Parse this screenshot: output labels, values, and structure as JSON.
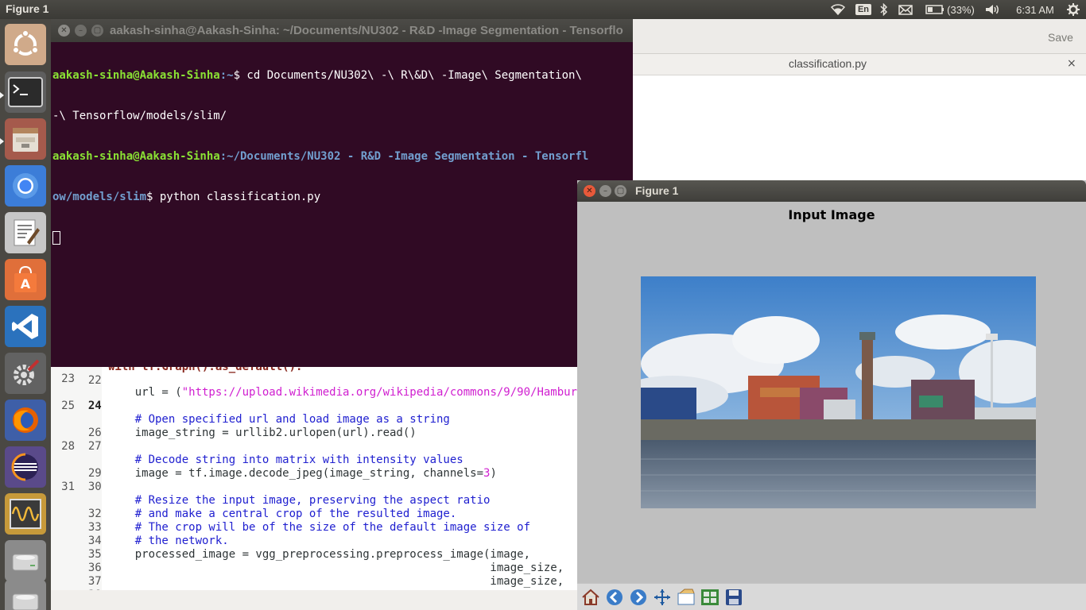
{
  "top_panel": {
    "app_name": "Figure 1",
    "keyboard": "En",
    "battery": "(33%)",
    "time": "6:31 AM"
  },
  "launcher": {
    "icons": [
      "ubuntu-icon",
      "terminal-icon",
      "files-icon",
      "chromium-icon",
      "text-editor-icon",
      "software-center-icon",
      "vscode-icon",
      "settings-icon",
      "firefox-icon",
      "eclipse-icon",
      "system-monitor-icon",
      "drive-icon",
      "drive-icon-2"
    ]
  },
  "terminal": {
    "title": "aakash-sinha@Aakash-Sinha: ~/Documents/NU302 - R&D -Image Segmentation - Tensorflo",
    "lines": [
      {
        "user": "aakash-sinha@Aakash-Sinha",
        "path": ":~",
        "cmd": "$ cd Documents/NU302\\ -\\ R\\&D\\ -Image\\ Segmentation\\"
      },
      {
        "user": "",
        "path": "",
        "cmd": "-\\ Tensorflow/models/slim/"
      },
      {
        "user": "aakash-sinha@Aakash-Sinha",
        "path": ":~/Documents/NU302 - R&D -Image Segmentation - Tensorfl",
        "cmd": ""
      },
      {
        "user": "",
        "path": "ow/models/slim",
        "cmd": "$ python classification.py"
      }
    ]
  },
  "editor": {
    "save_label": "Save",
    "tab_title": "classification.py",
    "tab_close": "×",
    "partial_line": "with tf.Graph().as_default():",
    "lines": [
      {
        "n": "22",
        "code": ""
      },
      {
        "n": "23",
        "code": ""
      },
      {
        "n": "24",
        "code_pre": "    url = (",
        "code_str": "\"https://upload.wikimedia.org/wikipedia/commons/9/90/Hambur"
      },
      {
        "n": "25",
        "code": ""
      },
      {
        "n": "26",
        "comment": "    # Open specified url and load image as a string"
      },
      {
        "n": "27",
        "code": "    image_string = urllib2.urlopen(url).read()"
      },
      {
        "n": "28",
        "code": ""
      },
      {
        "n": "29",
        "comment": "    # Decode string into matrix with intensity values"
      },
      {
        "n": "30",
        "code_pre": "    image = tf.image.decode_jpeg(image_string, channels=",
        "code_num": "3",
        "code_post": ")"
      },
      {
        "n": "31",
        "code": ""
      },
      {
        "n": "32",
        "comment": "    # Resize the input image, preserving the aspect ratio"
      },
      {
        "n": "33",
        "comment": "    # and make a central crop of the resulted image."
      },
      {
        "n": "34",
        "comment": "    # The crop will be of the size of the default image size of"
      },
      {
        "n": "35",
        "comment": "    # the network."
      },
      {
        "n": "36",
        "code": "    processed_image = vgg_preprocessing.preprocess_image(image,"
      },
      {
        "n": "37",
        "code": "                                                         image_size,"
      },
      {
        "n": "38",
        "code": "                                                         image_size,"
      }
    ]
  },
  "figure": {
    "window_title": "Figure 1",
    "plot_title": "Input Image",
    "toolbar": [
      "home-icon",
      "back-icon",
      "forward-icon",
      "pan-icon",
      "zoom-icon",
      "subplots-icon",
      "save-icon"
    ]
  }
}
